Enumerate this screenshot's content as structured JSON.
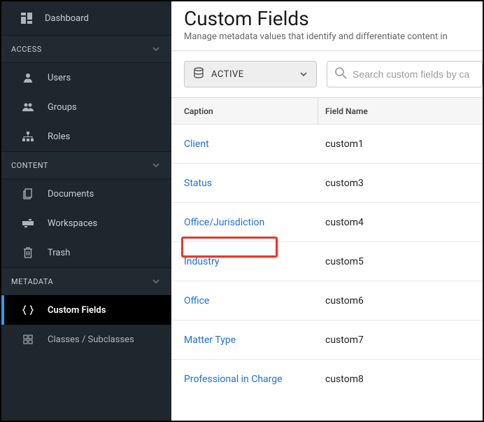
{
  "sidebar": {
    "dashboard": "Dashboard",
    "sections": {
      "access": {
        "title": "ACCESS",
        "items": [
          "Users",
          "Groups",
          "Roles"
        ]
      },
      "content": {
        "title": "CONTENT",
        "items": [
          "Documents",
          "Workspaces",
          "Trash"
        ]
      },
      "metadata": {
        "title": "METADATA",
        "items": [
          "Custom Fields",
          "Classes / Subclasses"
        ]
      }
    }
  },
  "page": {
    "title": "Custom Fields",
    "subtitle": "Manage metadata values that identify and differentiate content in"
  },
  "toolbar": {
    "status": "ACTIVE",
    "search_placeholder": "Search custom fields by ca"
  },
  "table": {
    "headers": {
      "caption": "Caption",
      "field": "Field Name"
    },
    "rows": [
      {
        "caption": "Client",
        "field": "custom1"
      },
      {
        "caption": "Status",
        "field": "custom3"
      },
      {
        "caption": "Office/Jurisdiction",
        "field": "custom4"
      },
      {
        "caption": "Industry",
        "field": "custom5"
      },
      {
        "caption": "Office",
        "field": "custom6"
      },
      {
        "caption": "Matter Type",
        "field": "custom7"
      },
      {
        "caption": "Professional in Charge",
        "field": "custom8"
      }
    ]
  }
}
